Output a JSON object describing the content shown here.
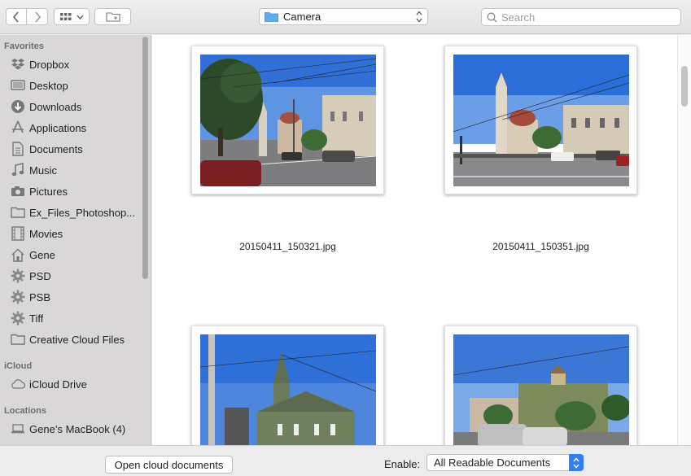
{
  "toolbar": {
    "path_label": "Camera",
    "search_placeholder": "Search"
  },
  "sidebar": {
    "favorites_header": "Favorites",
    "favorites": [
      {
        "label": "Dropbox",
        "icon": "dropbox-icon"
      },
      {
        "label": "Desktop",
        "icon": "desktop-icon"
      },
      {
        "label": "Downloads",
        "icon": "downloads-icon"
      },
      {
        "label": "Applications",
        "icon": "applications-icon"
      },
      {
        "label": "Documents",
        "icon": "documents-icon"
      },
      {
        "label": "Music",
        "icon": "music-icon"
      },
      {
        "label": "Pictures",
        "icon": "pictures-icon"
      },
      {
        "label": "Ex_Files_Photoshop...",
        "icon": "folder-icon"
      },
      {
        "label": "Movies",
        "icon": "movies-icon"
      },
      {
        "label": "Gene",
        "icon": "home-icon"
      },
      {
        "label": "PSD",
        "icon": "gear-icon"
      },
      {
        "label": "PSB",
        "icon": "gear-icon"
      },
      {
        "label": "Tiff",
        "icon": "gear-icon"
      },
      {
        "label": "Creative Cloud Files",
        "icon": "folder-icon"
      }
    ],
    "icloud_header": "iCloud",
    "icloud": [
      {
        "label": "iCloud Drive",
        "icon": "cloud-icon"
      }
    ],
    "locations_header": "Locations",
    "locations": [
      {
        "label": "Gene’s MacBook (4)",
        "icon": "laptop-icon"
      }
    ]
  },
  "files": [
    {
      "name": "20150411_150321.jpg"
    },
    {
      "name": "20150411_150351.jpg"
    },
    {
      "name": ""
    },
    {
      "name": ""
    }
  ],
  "bottom": {
    "cloud_button": "Open cloud documents",
    "enable_label": "Enable:",
    "enable_value": "All Readable Documents"
  },
  "colors": {
    "accent": "#2f7ff6",
    "sidebar_bg": "#d9d7d7",
    "folder_blue": "#5aaef0"
  }
}
